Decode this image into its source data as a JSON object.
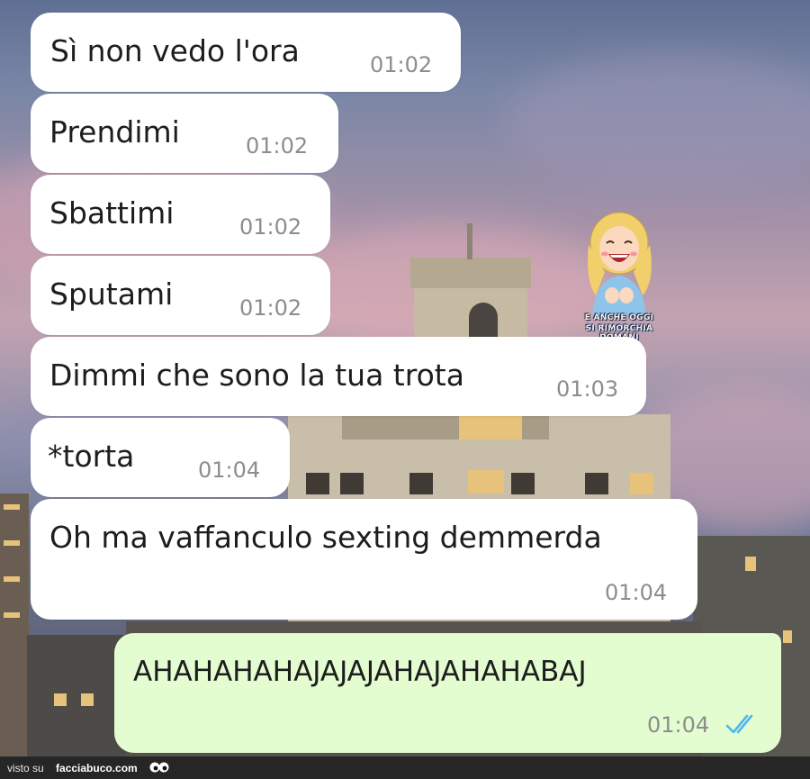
{
  "messages": [
    {
      "text": "Sì non vedo l'ora",
      "time": "01:02",
      "direction": "incoming"
    },
    {
      "text": "Prendimi",
      "time": "01:02",
      "direction": "incoming"
    },
    {
      "text": "Sbattimi",
      "time": "01:02",
      "direction": "incoming"
    },
    {
      "text": "Sputami",
      "time": "01:02",
      "direction": "incoming"
    },
    {
      "text": "Dimmi che sono la tua trota",
      "time": "01:03",
      "direction": "incoming"
    },
    {
      "text": "*torta",
      "time": "01:04",
      "direction": "incoming"
    },
    {
      "text": "Oh ma vaffanculo sexting demmerda",
      "time": "01:04",
      "direction": "incoming"
    },
    {
      "text": "AHAHAHAHAJAJAJAHAJAHAHABAJ",
      "time": "01:04",
      "direction": "outgoing",
      "read_status": "double-check-read-icon"
    }
  ],
  "sticker": {
    "line1": "E ANCHE OGGI",
    "line2": "SI RIMORCHIA DOMANI",
    "icon": "laughing-woman-sticker"
  },
  "watermark": {
    "prefix": "visto su",
    "brand": "facciabuco.com",
    "icon": "eyes-icon"
  },
  "colors": {
    "incoming_bubble": "#ffffff",
    "outgoing_bubble": "#e3fcd0",
    "read_ticks": "#4fb6ec",
    "timestamp": "#8d8d8d"
  }
}
